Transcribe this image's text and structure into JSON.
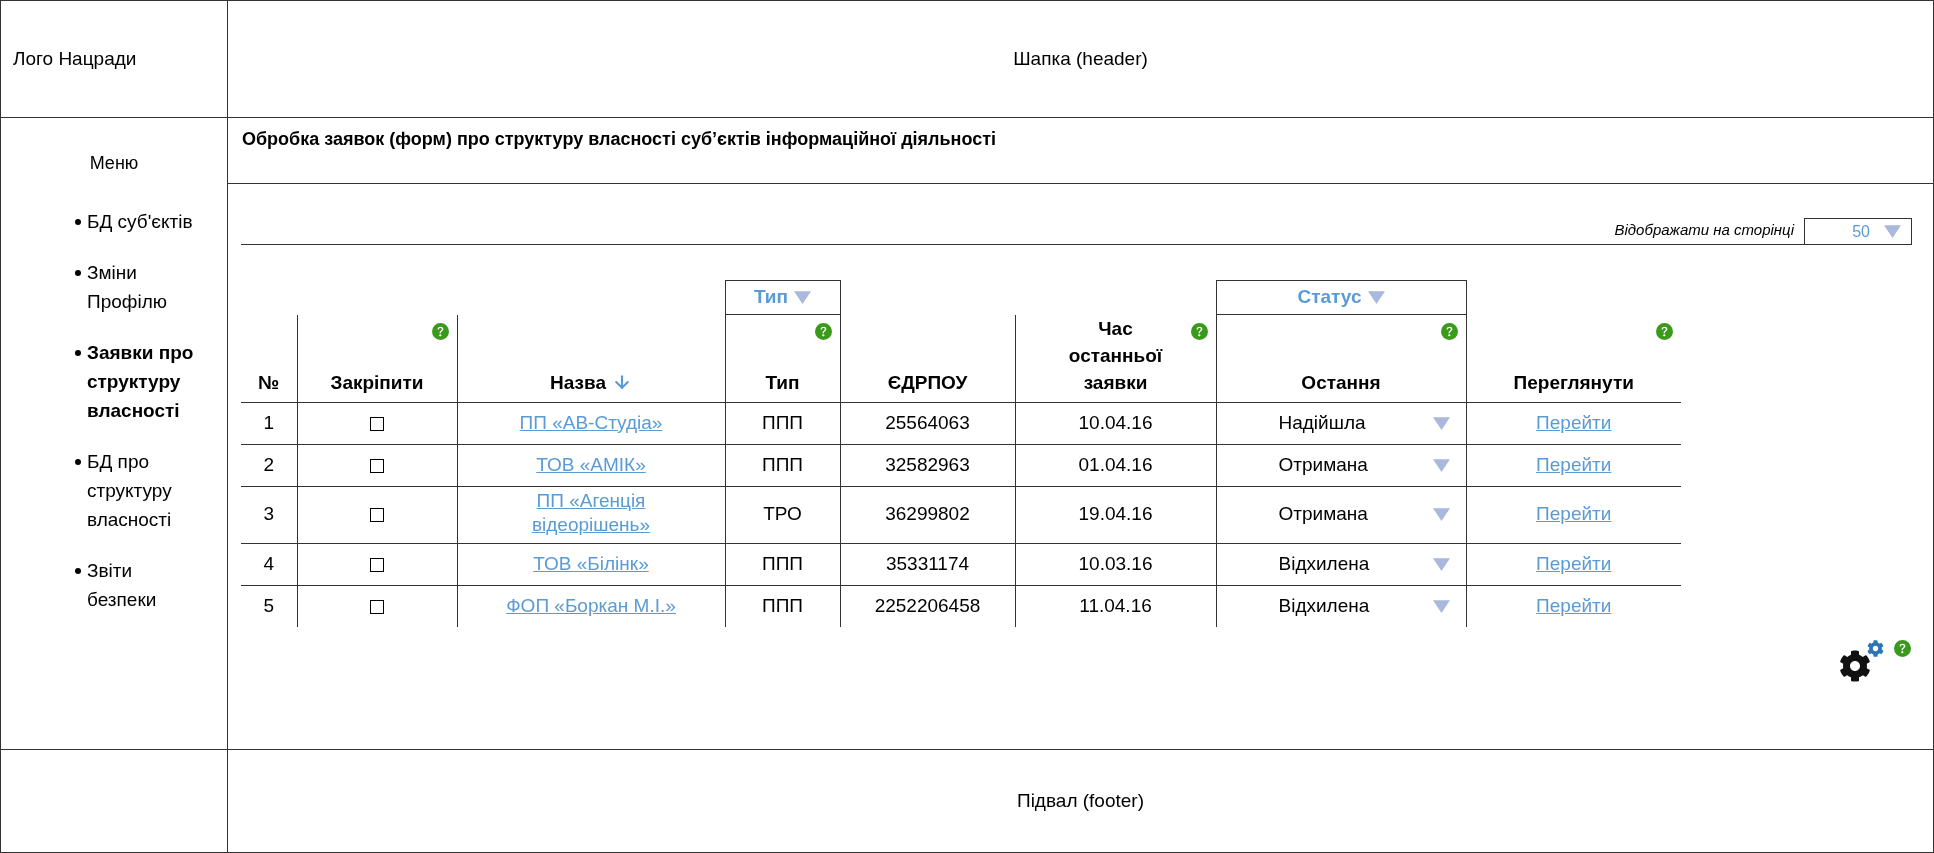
{
  "header": {
    "logo": "Лого Нацради",
    "title": "Шапка (header)"
  },
  "menu": {
    "title": "Меню",
    "items": [
      {
        "label": "БД суб'єктів",
        "selected": false
      },
      {
        "label": "Зміни Профілю",
        "selected": false
      },
      {
        "label": "Заявки про структуру власності",
        "selected": true
      },
      {
        "label": "БД про структуру власності",
        "selected": false
      },
      {
        "label": "Звіти безпеки",
        "selected": false
      }
    ]
  },
  "page_title": "Обробка заявок (форм) про структуру власності суб’єктів інформаційної діяльності",
  "per_page": {
    "label": "Відображати на сторінці",
    "value": "50"
  },
  "table": {
    "columns": [
      {
        "label": "№",
        "help": false,
        "sorted": false
      },
      {
        "label": "Закріпити",
        "help": true,
        "sorted": false
      },
      {
        "label": "Назва",
        "help": false,
        "sorted": true
      },
      {
        "label": "Тип",
        "help": true,
        "sorted": false,
        "group": "Тип"
      },
      {
        "label": "ЄДРПОУ",
        "help": false,
        "sorted": false
      },
      {
        "label": "Час останньої заявки",
        "help": true,
        "sorted": false
      },
      {
        "label": "Остання",
        "help": true,
        "sorted": false,
        "group": "Статус"
      },
      {
        "label": "Переглянути",
        "help": true,
        "sorted": false
      }
    ],
    "rows": [
      {
        "number": "1",
        "pinned": false,
        "name": "ПП «АВ-Студіа»",
        "type": "ППП",
        "edrpou": "25564063",
        "time": "10.04.16",
        "status": "Надійшла",
        "action": "Перейти"
      },
      {
        "number": "2",
        "pinned": false,
        "name": "ТОВ «АМІК»",
        "type": "ППП",
        "edrpou": "32582963",
        "time": "01.04.16",
        "status": "Отримана",
        "action": "Перейти"
      },
      {
        "number": "3",
        "pinned": false,
        "name": "ПП «Агенція відеорішень»",
        "type": "ТРО",
        "edrpou": "36299802",
        "time": "19.04.16",
        "status": "Отримана",
        "action": "Перейти"
      },
      {
        "number": "4",
        "pinned": false,
        "name": "ТОВ «Білінк»",
        "type": "ППП",
        "edrpou": "35331174",
        "time": "10.03.16",
        "status": "Відхилена",
        "action": "Перейти"
      },
      {
        "number": "5",
        "pinned": false,
        "name": "ФОП «Боркан М.І.»",
        "type": "ППП",
        "edrpou": "2252206458",
        "time": "11.04.16",
        "status": "Відхилена",
        "action": "Перейти"
      }
    ]
  },
  "footer": "Підвал (footer)"
}
